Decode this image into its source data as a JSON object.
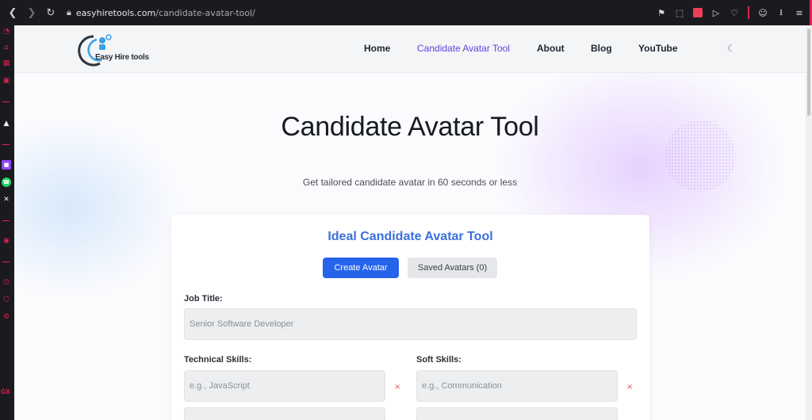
{
  "browser": {
    "url_host": "easyhiretools.com",
    "url_path": "/candidate-avatar-tool/"
  },
  "sidebar": {
    "bottom_label": "GX"
  },
  "site": {
    "logo_text": "Easy Hire tools",
    "nav": [
      {
        "label": "Home"
      },
      {
        "label": "Candidate Avatar Tool",
        "active": true
      },
      {
        "label": "About"
      },
      {
        "label": "Blog"
      },
      {
        "label": "YouTube"
      }
    ]
  },
  "hero": {
    "title": "Candidate Avatar Tool",
    "subtitle": "Get tailored candidate avatar in 60 seconds or less"
  },
  "tool": {
    "title": "Ideal Candidate Avatar Tool",
    "create_button": "Create Avatar",
    "saved_button": "Saved Avatars (0)",
    "job_title_label": "Job Title:",
    "job_title_placeholder": "Senior Software Developer",
    "technical_skills_label": "Technical Skills:",
    "technical_skill_placeholder": "e.g., JavaScript",
    "soft_skills_label": "Soft Skills:",
    "soft_skill_placeholder": "e.g., Communication",
    "remove_symbol": "×"
  },
  "colors": {
    "accent": "#2563eb",
    "nav_active": "#5b46e0",
    "browser_accent": "#e0224e"
  }
}
